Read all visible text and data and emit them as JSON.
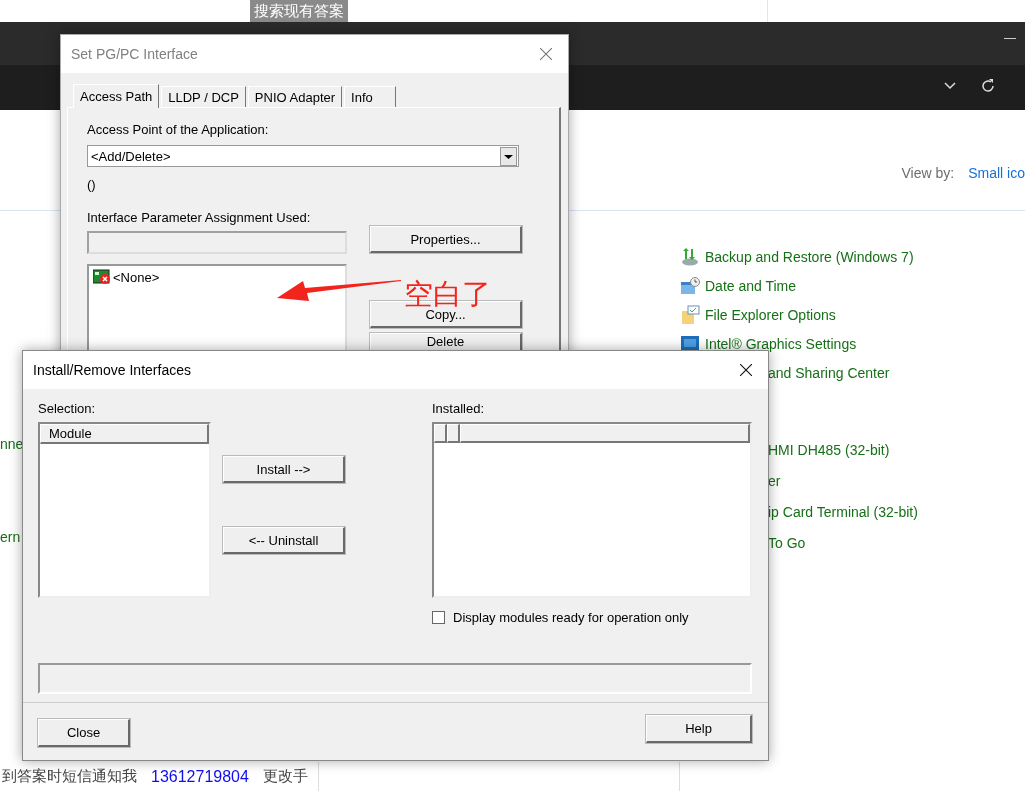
{
  "top_banner": {
    "label": "搜索现有答案"
  },
  "control_panel": {
    "view_by_label": "View by:",
    "view_by_value": "Small ico",
    "items": [
      {
        "label": "Backup and Restore (Windows 7)",
        "kind": "backup"
      },
      {
        "label": "Date and Time",
        "kind": "calendar"
      },
      {
        "label": "File Explorer Options",
        "kind": "folder"
      },
      {
        "label": "Intel® Graphics Settings",
        "kind": "monitor"
      },
      {
        "label": "and Sharing Center",
        "kind": "partial"
      }
    ],
    "lower_items": [
      {
        "label": "HMI DH485 (32-bit)",
        "kind": "partial"
      },
      {
        "label": "er",
        "kind": "partial"
      },
      {
        "label": "ip Card Terminal (32-bit)",
        "kind": "partial"
      },
      {
        "label": "To Go",
        "kind": "partial"
      }
    ],
    "left_fragments": [
      {
        "label": "nne"
      },
      {
        "label": "ern"
      }
    ]
  },
  "pgpc_dialog": {
    "title": "Set PG/PC Interface",
    "tabs": [
      {
        "label": "Access Path",
        "selected": true
      },
      {
        "label": "LLDP / DCP",
        "selected": false
      },
      {
        "label": "PNIO Adapter",
        "selected": false
      },
      {
        "label": "Info",
        "selected": false
      }
    ],
    "access_point_label": "Access Point of the Application:",
    "access_point_value": "<Add/Delete>",
    "access_point_note": "()",
    "assignment_label": "Interface Parameter Assignment Used:",
    "assignment_list": [
      "<None>"
    ],
    "buttons": [
      "Properties...",
      "Copy...",
      "Delete"
    ]
  },
  "install_dialog": {
    "title": "Install/Remove Interfaces",
    "selection_label": "Selection:",
    "selection_column": "Module",
    "install_button": "Install -->",
    "uninstall_button": "<-- Uninstall",
    "installed_label": "Installed:",
    "ready_only": {
      "label": "Display modules ready for operation only",
      "checked": false
    },
    "close_button": "Close",
    "help_button": "Help"
  },
  "annotation": {
    "label": "空白了"
  },
  "footer": {
    "notice": "到答案时短信通知我",
    "phone": "13612719804",
    "change": "更改手"
  }
}
